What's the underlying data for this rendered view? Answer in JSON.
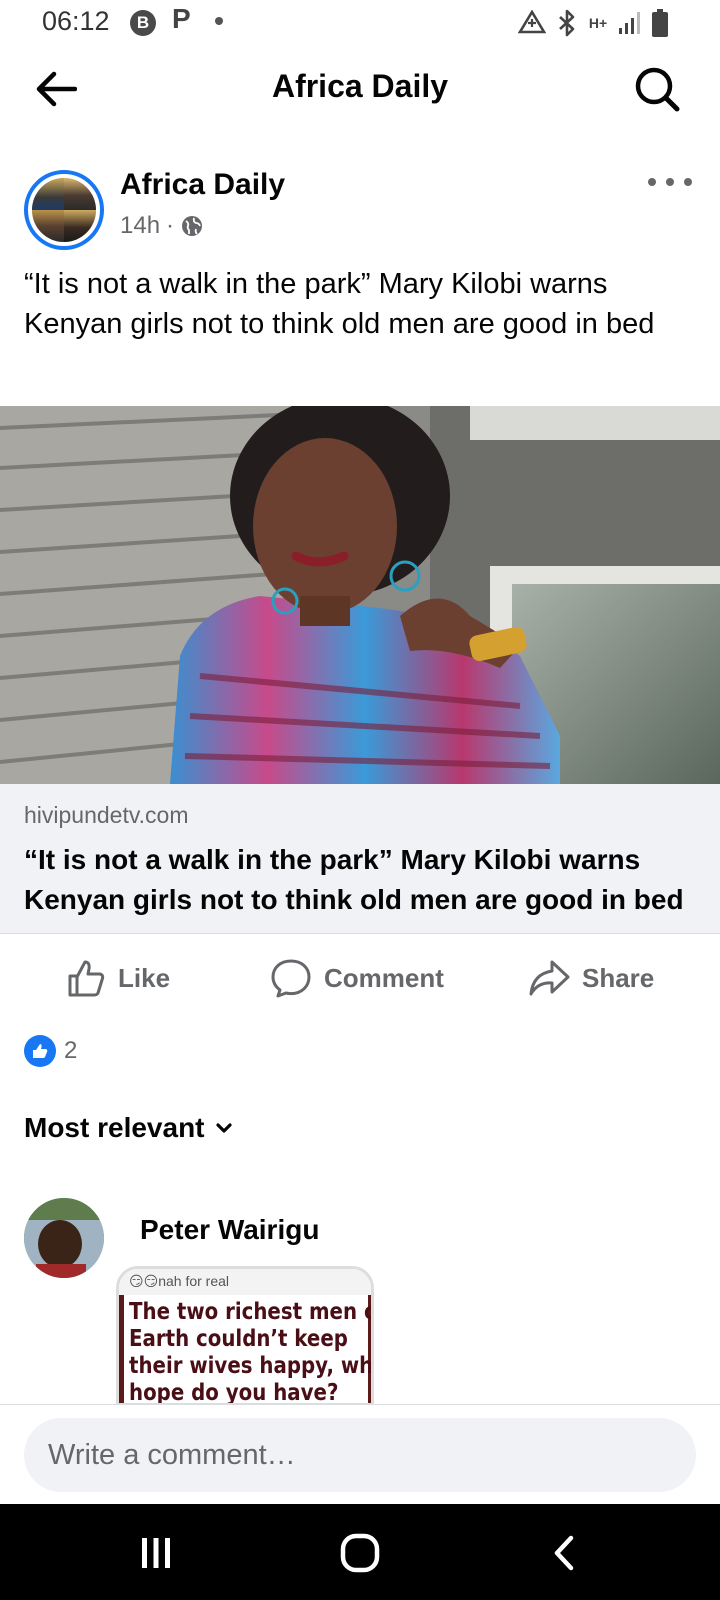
{
  "status_bar": {
    "time": "06:12",
    "notif_b": "B",
    "notif_p": "P",
    "network": "H+"
  },
  "header": {
    "title": "Africa Daily",
    "back_icon": "arrow-left-icon",
    "search_icon": "search-icon"
  },
  "post": {
    "page_name": "Africa Daily",
    "time": "14h",
    "separator": "·",
    "privacy_icon": "globe-icon",
    "text": "“It is not a walk in the park” Mary Kilobi warns Kenyan girls not to think old men are good in bed",
    "link": {
      "domain": "hivipundetv.com",
      "title_line1": "“It is not a walk in the park” Mary Kilobi warns",
      "title_line2": "Kenyan girls not to think old men are good in bed"
    },
    "actions": {
      "like": "Like",
      "comment": "Comment",
      "share": "Share"
    },
    "reaction_count": "2"
  },
  "comments": {
    "sort_label": "Most relevant",
    "items": [
      {
        "author": "Peter Wairigu",
        "meme_caption": "nah for real",
        "meme_lines": [
          "The two richest men on",
          "Earth couldn’t keep",
          "their wives happy, what",
          "hope do you have?"
        ]
      }
    ]
  },
  "composer": {
    "placeholder": "Write a comment…"
  },
  "colors": {
    "accent": "#1877f2",
    "secondary_text": "#65676b",
    "preview_bg": "#f0f2f5"
  }
}
